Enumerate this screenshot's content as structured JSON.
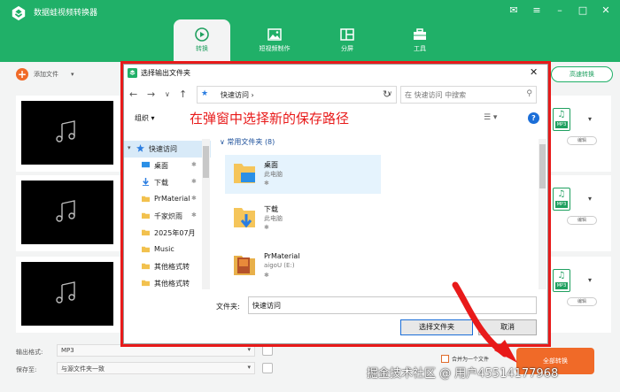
{
  "app": {
    "title": "数据蛙视频转换器",
    "window_controls": [
      "✉",
      "≡",
      "–",
      "□",
      "✕"
    ],
    "nav_tabs": [
      {
        "label": "转换",
        "icon": "convert-icon",
        "active": true
      },
      {
        "label": "短视频制作",
        "icon": "image-icon",
        "active": false
      },
      {
        "label": "分屏",
        "icon": "split-screen-icon",
        "active": false
      },
      {
        "label": "工具",
        "icon": "toolbox-icon",
        "active": false
      }
    ],
    "accent_color": "#20b068",
    "orange_color": "#f06a28"
  },
  "toolbar": {
    "add_file_label": "添加文件",
    "add_file_caret": "▾",
    "fast_convert_label": "高速转换"
  },
  "file_rows": [
    {
      "format": "MP3",
      "button": "编辑",
      "caret": "▾"
    },
    {
      "format": "MP3",
      "button": "编辑",
      "caret": "▾"
    },
    {
      "format": "MP3",
      "button": "编辑",
      "caret": "▾"
    }
  ],
  "bottom": {
    "output_format_label": "输出格式:",
    "output_format_value": "MP3",
    "save_to_label": "保存至:",
    "save_to_value": "与源文件夹一致",
    "merge_label": "合并为一个文件",
    "convert_all_label": "全部转换"
  },
  "dialog": {
    "title": "选择输出文件夹",
    "close": "✕",
    "nav_buttons": [
      "←",
      "→",
      "∨",
      "↑"
    ],
    "address_path": "快速访问 ›",
    "address_dd": "∨",
    "refresh": "↻",
    "search_placeholder": "在 快速访问 中搜索",
    "organize_label": "组织 ▾",
    "view_label": "☰ ▾",
    "help_label": "?",
    "annotation": "在弹窗中选择新的保存路径",
    "nav_pane": [
      {
        "label": "快速访问",
        "icon": "star-icon",
        "expander": "▾",
        "selected": true,
        "pinned": false
      },
      {
        "label": "桌面",
        "icon": "desktop-folder-icon",
        "pinned": true
      },
      {
        "label": "下载",
        "icon": "download-folder-icon",
        "pinned": true
      },
      {
        "label": "PrMaterial",
        "icon": "folder-icon",
        "pinned": true
      },
      {
        "label": "千家炽雨",
        "icon": "folder-icon",
        "pinned": true
      },
      {
        "label": "2025年07月",
        "icon": "folder-icon",
        "pinned": false
      },
      {
        "label": "Music",
        "icon": "folder-icon",
        "pinned": false
      },
      {
        "label": "其他格式转",
        "icon": "folder-icon",
        "pinned": false
      },
      {
        "label": "其他格式转",
        "icon": "folder-icon",
        "pinned": false
      }
    ],
    "pin_glyph": "📌",
    "group_header": "∨ 常用文件夹 (8)",
    "folders": [
      {
        "name": "桌面",
        "sub": "此电脑",
        "icon": "desktop-folder-icon"
      },
      {
        "name": "下载",
        "sub": "此电脑",
        "icon": "download-folder-icon"
      },
      {
        "name": "PrMaterial",
        "sub": "aigoU (E:)",
        "icon": "picture-folder-icon"
      }
    ],
    "filename_label": "文件夹:",
    "filename_value": "快速访问",
    "select_button": "选择文件夹",
    "cancel_button": "取消",
    "highlight_color": "#e81a1a"
  },
  "watermark": "掘金技术社区 @ 用户45514177968"
}
